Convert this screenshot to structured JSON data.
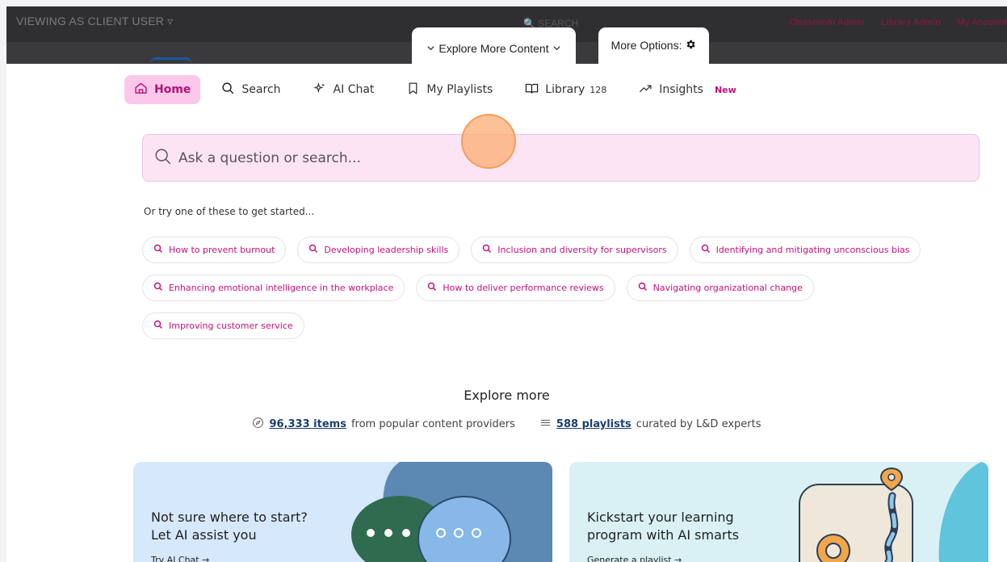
{
  "topbar": {
    "viewing": "VIEWING AS CLIENT USER ▿",
    "search": "🔍 SEARCH",
    "admin_links": [
      "Classroom Admin",
      "Library Admin",
      "My Account"
    ]
  },
  "tabs": {
    "explore": "Explore More Content",
    "more_options": "More Options:"
  },
  "nav": {
    "home": "Home",
    "search": "Search",
    "ai_chat": "AI Chat",
    "playlists": "My Playlists",
    "library": "Library",
    "library_count": "128",
    "insights": "Insights",
    "insights_badge": "New"
  },
  "search": {
    "placeholder": "Ask a question or search..."
  },
  "suggestions": {
    "label": "Or try one of these to get started...",
    "row1": [
      "How to prevent burnout",
      "Developing leadership skills",
      "Inclusion and diversity for supervisors",
      "Identifying and mitigating unconscious bias"
    ],
    "row2": [
      "Enhancing emotional intelligence in the workplace",
      "How to deliver performance reviews",
      "Navigating organizational change"
    ],
    "row3": [
      "Improving customer service"
    ]
  },
  "explore": {
    "title": "Explore more",
    "items_count": "96,333 items",
    "items_suffix": "from popular content providers",
    "playlists_count": "588 playlists",
    "playlists_suffix": "curated by L&D experts"
  },
  "cards": {
    "ai_title": "Not sure where to start? Let AI assist you",
    "ai_link": "Try AI Chat →",
    "kick_title": "Kickstart your learning program with AI smarts",
    "kick_link": "Generate a playlist →"
  },
  "colors": {
    "accent": "#c4127f",
    "active_nav_bg": "#fbc8eb",
    "search_bg": "#fde4f4",
    "link": "#1c3f6f"
  }
}
